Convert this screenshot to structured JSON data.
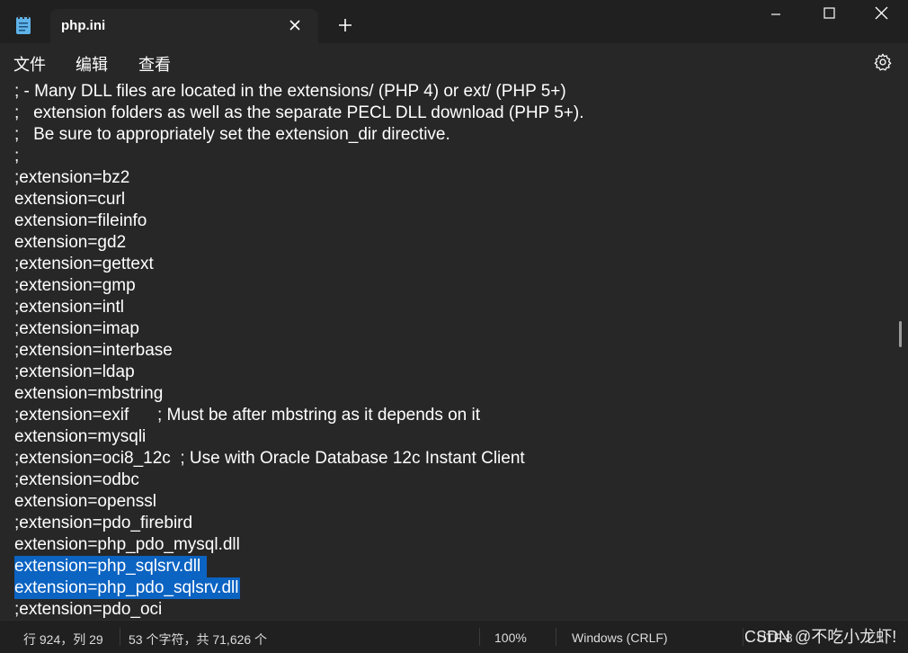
{
  "window": {
    "tab_title": "php.ini",
    "new_tab_label": "+"
  },
  "menu": {
    "file": "文件",
    "edit": "编辑",
    "view": "查看"
  },
  "editor": {
    "lines": [
      "; - Many DLL files are located in the extensions/ (PHP 4) or ext/ (PHP 5+)",
      ";   extension folders as well as the separate PECL DLL download (PHP 5+).",
      ";   Be sure to appropriately set the extension_dir directive.",
      ";",
      ";extension=bz2",
      "extension=curl",
      "extension=fileinfo",
      "extension=gd2",
      ";extension=gettext",
      ";extension=gmp",
      ";extension=intl",
      ";extension=imap",
      ";extension=interbase",
      ";extension=ldap",
      "extension=mbstring",
      ";extension=exif      ; Must be after mbstring as it depends on it",
      "extension=mysqli",
      ";extension=oci8_12c  ; Use with Oracle Database 12c Instant Client",
      ";extension=odbc",
      "extension=openssl",
      ";extension=pdo_firebird",
      "extension=php_pdo_mysql.dll",
      "extension=php_sqlsrv.dll ",
      "extension=php_pdo_sqlsrv.dll",
      ";extension=pdo_oci"
    ],
    "selected_lines": [
      22,
      23
    ],
    "selection_color": "#0b63c2"
  },
  "status": {
    "position": "行 924，列 29",
    "char_count": "53 个字符，共 71,626 个",
    "zoom": "100%",
    "line_ending": "Windows (CRLF)",
    "encoding": "UTF-8"
  },
  "watermark": "CSDN @不吃小龙虾!",
  "icons": [
    "notepad-icon",
    "close-icon",
    "plus-icon",
    "minimize-icon",
    "maximize-icon",
    "close-window-icon",
    "gear-icon"
  ]
}
